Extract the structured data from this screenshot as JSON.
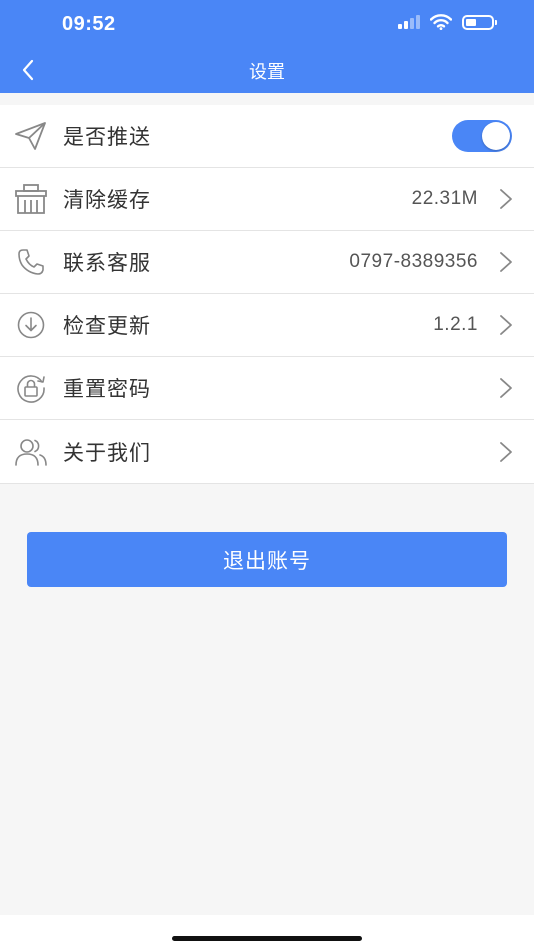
{
  "status_bar": {
    "time": "09:52"
  },
  "nav": {
    "title": "设置",
    "back_icon": "chevron-left-icon"
  },
  "settings": {
    "push": {
      "label": "是否推送",
      "icon": "paper-plane-icon",
      "toggle_on": true
    },
    "clear_cache": {
      "label": "清除缓存",
      "value": "22.31M",
      "icon": "basket-icon"
    },
    "contact": {
      "label": "联系客服",
      "value": "0797-8389356",
      "icon": "phone-icon"
    },
    "update": {
      "label": "检查更新",
      "value": "1.2.1",
      "icon": "download-circle-icon"
    },
    "reset_password": {
      "label": "重置密码",
      "icon": "lock-reset-icon"
    },
    "about": {
      "label": "关于我们",
      "icon": "users-icon"
    }
  },
  "logout": {
    "label": "退出账号"
  },
  "colors": {
    "primary": "#4a86f6",
    "background": "#f6f6f6",
    "divider": "#e4e4e4",
    "text": "#333333"
  }
}
